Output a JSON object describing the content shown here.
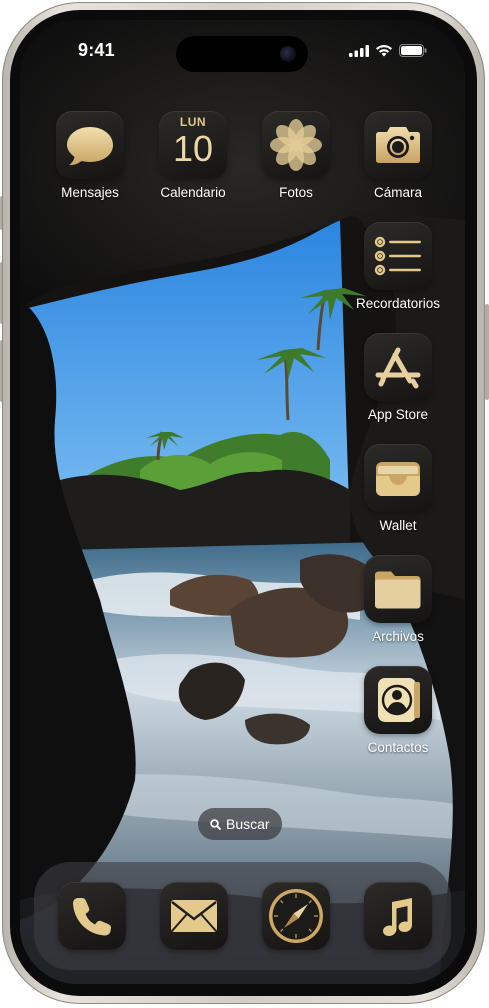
{
  "status_bar": {
    "time": "9:41",
    "icons": [
      "signal-icon",
      "wifi-icon",
      "battery-icon"
    ]
  },
  "calendar": {
    "weekday": "LUN",
    "day": "10"
  },
  "apps": [
    {
      "id": "messages",
      "label": "Mensajes",
      "icon": "speech-bubble-icon"
    },
    {
      "id": "calendar",
      "label": "Calendario",
      "icon": "calendar-icon"
    },
    {
      "id": "photos",
      "label": "Fotos",
      "icon": "flower-icon"
    },
    {
      "id": "camera",
      "label": "Cámara",
      "icon": "camera-icon"
    },
    {
      "id": "reminders",
      "label": "Recordatorios",
      "icon": "list-icon"
    },
    {
      "id": "app-store",
      "label": "App Store",
      "icon": "app-store-icon"
    },
    {
      "id": "wallet",
      "label": "Wallet",
      "icon": "wallet-icon"
    },
    {
      "id": "files",
      "label": "Archivos",
      "icon": "folder-icon"
    },
    {
      "id": "contacts",
      "label": "Contactos",
      "icon": "contact-icon"
    }
  ],
  "search": {
    "label": "Buscar",
    "icon": "search-icon"
  },
  "dock": [
    {
      "id": "phone",
      "icon": "phone-icon"
    },
    {
      "id": "mail",
      "icon": "mail-icon"
    },
    {
      "id": "safari",
      "icon": "compass-icon"
    },
    {
      "id": "music",
      "icon": "music-note-icon"
    }
  ],
  "colors": {
    "icon_tint": "#d9bf86",
    "icon_tile": "#1f1e1c",
    "label_text": "#ffffff",
    "sky": "#2f8fe6"
  }
}
